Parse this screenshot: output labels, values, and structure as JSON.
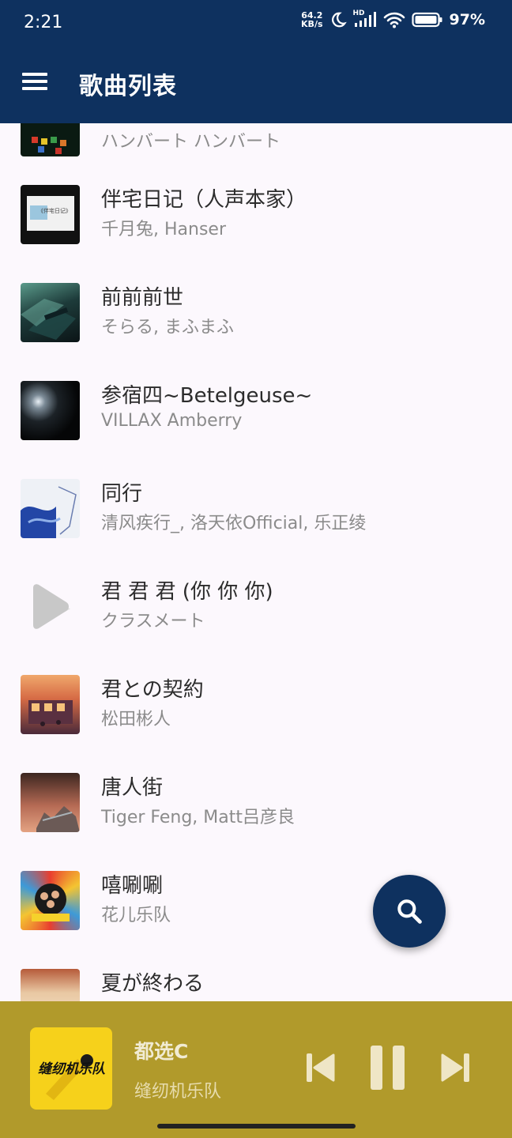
{
  "status_bar": {
    "time": "2:21",
    "net_speed_value": "64.2",
    "net_speed_unit": "KB/s",
    "hd_label": "HD",
    "battery": "97%"
  },
  "app_bar": {
    "title": "歌曲列表"
  },
  "songs": [
    {
      "title": "",
      "artist": "ハンバート ハンバート"
    },
    {
      "title": "伴宅日记（人声本家）",
      "artist": "千月兔, Hanser",
      "cover_text": "《伴宅日记》"
    },
    {
      "title": "前前前世",
      "artist": "そらる, まふまふ"
    },
    {
      "title": "参宿四~Betelgeuse~",
      "artist": "VILLAX Amberry"
    },
    {
      "title": "同行",
      "artist": "清风疾行_, 洛天依Official, 乐正绫"
    },
    {
      "title": "君 君 君 (你 你 你)",
      "artist": "クラスメート"
    },
    {
      "title": "君との契約",
      "artist": "松田彬人"
    },
    {
      "title": "唐人街",
      "artist": "Tiger Feng, Matt吕彦良"
    },
    {
      "title": "嘻唰唰",
      "artist": "花儿乐队"
    },
    {
      "title": "夏が終わる",
      "artist": ""
    }
  ],
  "now_playing": {
    "title": "都选C",
    "artist": "缝纫机乐队",
    "cover_text": "缝纫机乐队",
    "state": "playing"
  },
  "colors": {
    "primary": "#0e315f",
    "background": "#fcf8fd",
    "player_background": "#b19a2b",
    "title_text": "#2c2c2c",
    "subtitle_text": "#8b8b8b"
  },
  "icons": {
    "menu": "menu-icon",
    "search": "search-icon",
    "previous": "skip-previous-icon",
    "pause": "pause-icon",
    "next": "skip-next-icon",
    "placeholder": "play-placeholder-icon"
  }
}
